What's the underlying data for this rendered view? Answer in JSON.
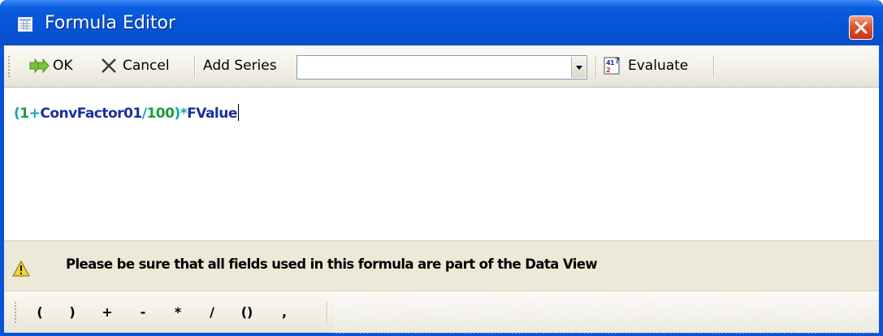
{
  "window": {
    "title": "Formula Editor",
    "title_icon": "table-icon",
    "close_icon": "close-icon",
    "title_bar_color": "#0752d6",
    "close_button_color": "#e0532a"
  },
  "toolbar": {
    "ok_label": "OK",
    "ok_icon": "double-arrow-icon",
    "cancel_label": "Cancel",
    "cancel_icon": "x-icon",
    "add_series_label": "Add Series",
    "series_combo_value": "",
    "evaluate_label": "Evaluate",
    "evaluate_icon": "calculator-icon"
  },
  "formula": {
    "tokens": [
      {
        "text": "(",
        "color": "#14a6a6"
      },
      {
        "text": "1",
        "color": "#1a9e3a"
      },
      {
        "text": "+",
        "color": "#14a6a6"
      },
      {
        "text": "ConvFactor01",
        "color": "#1a2f9e"
      },
      {
        "text": "/",
        "color": "#14a6a6"
      },
      {
        "text": "100",
        "color": "#1a9e3a"
      },
      {
        "text": ")*",
        "color": "#14a6a6"
      },
      {
        "text": "FValue",
        "color": "#1a2f9e"
      }
    ]
  },
  "warning": {
    "icon": "warning-icon",
    "text": "Please be sure that all fields used in this formula are part of the Data View"
  },
  "operators": [
    "(",
    ")",
    "+",
    "-",
    "*",
    "/",
    "()",
    ","
  ]
}
